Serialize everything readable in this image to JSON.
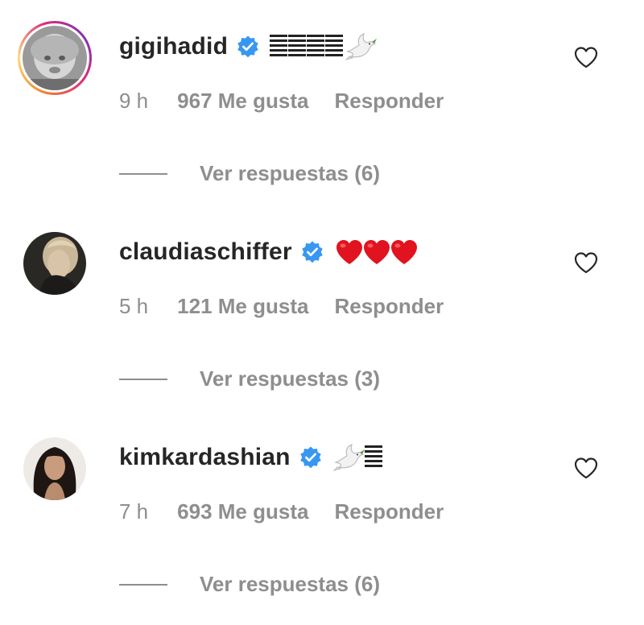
{
  "comments": [
    {
      "username": "gigihadid",
      "time": "9 h",
      "likes": "967 Me gusta",
      "reply_label": "Responder",
      "view_replies": "Ver respuestas (6)",
      "has_story_ring": true,
      "content_icons": [
        "bars-emoji",
        "bars-emoji",
        "bars-emoji",
        "bars-emoji",
        "dove-emoji"
      ]
    },
    {
      "username": "claudiaschiffer",
      "time": "5 h",
      "likes": "121 Me gusta",
      "reply_label": "Responder",
      "view_replies": "Ver respuestas (3)",
      "has_story_ring": false,
      "content_icons": [
        "red-heart-emoji",
        "red-heart-emoji",
        "red-heart-emoji"
      ]
    },
    {
      "username": "kimkardashian",
      "time": "7 h",
      "likes": "693 Me gusta",
      "reply_label": "Responder",
      "view_replies": "Ver respuestas (6)",
      "has_story_ring": false,
      "content_icons": [
        "dove-emoji",
        "bars-emoji"
      ]
    }
  ],
  "colors": {
    "text_primary": "#262626",
    "text_secondary": "#8e8e8e",
    "verified_blue": "#3897f0",
    "heart_red": "#e0131f"
  }
}
